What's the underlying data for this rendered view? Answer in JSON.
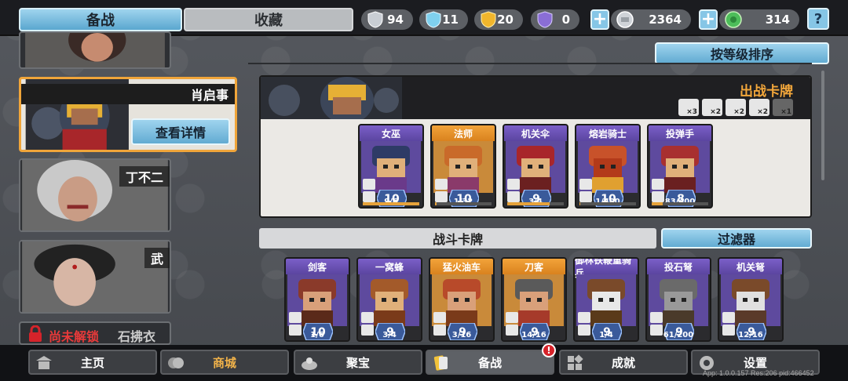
{
  "tabs": {
    "active": "备战",
    "inactive": "收藏"
  },
  "resources": {
    "silver_shield": "94",
    "crystal": "11",
    "gold_trophy": "20",
    "purple_badge": "0",
    "coins": "2364",
    "gems": "314",
    "help_label": "?"
  },
  "sort_button": "按等级排序",
  "heroes": [
    {
      "name": ""
    },
    {
      "name": "肖启事",
      "detail_button": "查看详情"
    },
    {
      "name": "丁不二"
    },
    {
      "name": "武"
    },
    {
      "name": "石拂衣",
      "locked_label": "尚未解锁"
    }
  ],
  "deck": {
    "title": "出战卡牌",
    "class_limits": [
      "×3",
      "×2",
      "×2",
      "×2",
      "×1"
    ],
    "cards": [
      {
        "name": "女巫",
        "level": "10",
        "count": "9/6",
        "progress": 1.0
      },
      {
        "name": "法师",
        "level": "10",
        "count": "1/32",
        "progress": 0.03
      },
      {
        "name": "机关伞",
        "level": "9",
        "count": "3/4",
        "progress": 0.75
      },
      {
        "name": "熔岩骑士",
        "level": "10",
        "count": "1/400",
        "progress": 0.01
      },
      {
        "name": "投弹手",
        "level": "8",
        "count": "83/400",
        "progress": 0.2
      }
    ]
  },
  "battle": {
    "title": "战斗卡牌",
    "filter_button": "过滤器",
    "cards": [
      {
        "name": "剑客",
        "level": "10",
        "count": "1/6"
      },
      {
        "name": "一窝蜂",
        "level": "9",
        "count": "3/4"
      },
      {
        "name": "猛火油车",
        "level": "9",
        "count": "3/16"
      },
      {
        "name": "刀客",
        "level": "9",
        "count": "14/16"
      },
      {
        "name": "御林铁鞭重骑兵",
        "level": "9",
        "count": "1/4"
      },
      {
        "name": "投石弩",
        "level": "9",
        "count": "61/200"
      },
      {
        "name": "机关弩",
        "level": "9",
        "count": "12/16"
      }
    ]
  },
  "nav": {
    "home": "主页",
    "shop": "商城",
    "treasure": "聚宝",
    "prepare": "备战",
    "achievements": "成就",
    "settings": "设置",
    "badge": "!"
  },
  "version_text": "App: 1.0.0.157 Res:206 pid:466452",
  "colors": {
    "accent_blue": "#62abd2",
    "gold_text": "#f3a73b",
    "shop_text": "#f2b34a",
    "lock_red": "#d6232a"
  }
}
